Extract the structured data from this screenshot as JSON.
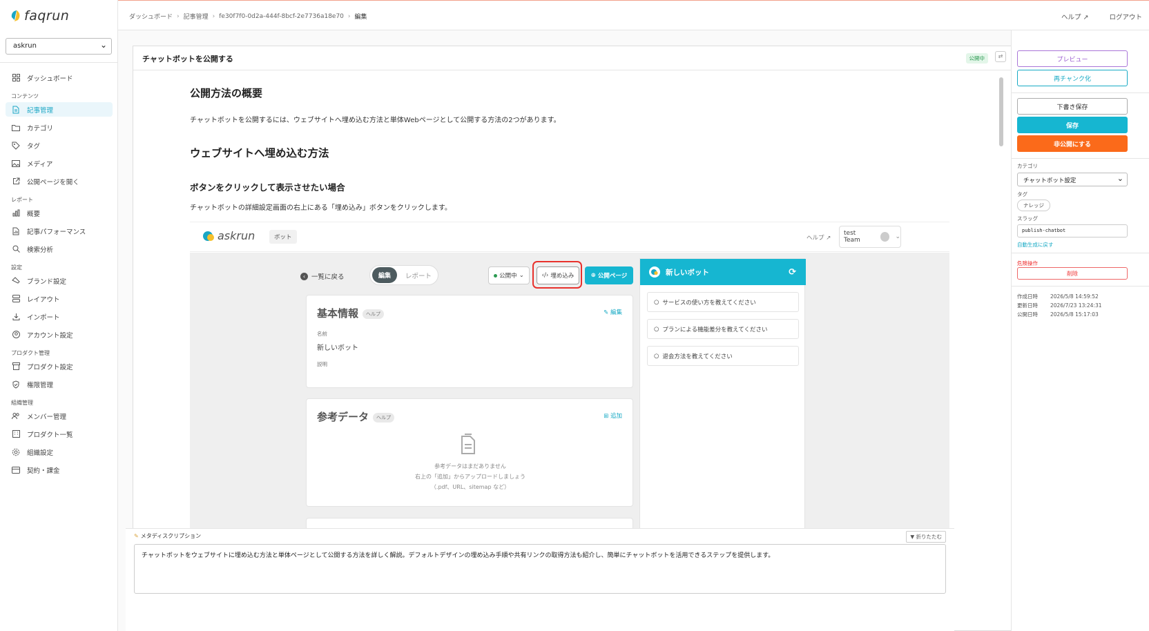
{
  "app": {
    "logo_text": "faqrun",
    "workspace": "askrun"
  },
  "sidebar": {
    "items": [
      {
        "label": "ダッシュボード",
        "icon": "grid-icon"
      }
    ],
    "sections": [
      {
        "title": "コンテンツ",
        "items": [
          "記事管理",
          "カテゴリ",
          "タグ",
          "メディア",
          "公開ページを開く"
        ]
      },
      {
        "title": "レポート",
        "items": [
          "概要",
          "記事パフォーマンス",
          "検索分析"
        ]
      },
      {
        "title": "設定",
        "items": [
          "ブランド設定",
          "レイアウト",
          "インポート",
          "アカウント設定"
        ]
      },
      {
        "title": "プロダクト管理",
        "items": [
          "プロダクト設定",
          "権限管理"
        ]
      },
      {
        "title": "組織管理",
        "items": [
          "メンバー管理",
          "プロダクト一覧",
          "組織設定",
          "契約・課金"
        ]
      }
    ]
  },
  "header": {
    "breadcrumb": [
      "ダッシュボード",
      "記事管理",
      "fe30f7f0-0d2a-444f-8bcf-2e7736a18e70",
      "編集"
    ],
    "help": "ヘルプ",
    "logout": "ログアウト"
  },
  "editor": {
    "title": "チャットボットを公開する",
    "status_badge": "公開中",
    "h_overview": "公開方法の概要",
    "p_overview": "チャットボットを公開するには、ウェブサイトへ埋め込む方法と単体Webページとして公開する方法の2つがあります。",
    "h_embed": "ウェブサイトへ埋め込む方法",
    "h_button": "ボタンをクリックして表示させたい場合",
    "p_button": "チャットボットの詳細設定画面の右上にある「埋め込み」ボタンをクリックします。"
  },
  "screenshot": {
    "logo_text": "askrun",
    "bot_chip": "ボット",
    "help": "ヘルプ ↗",
    "team": "test Team",
    "back": "一覧に戻る",
    "seg_edit": "編集",
    "seg_report": "レポート",
    "pub_select": "公開中",
    "embed": "埋め込み",
    "public_page": "公開ページ",
    "basic_title": "基本情報",
    "help_chip": "ヘルプ",
    "edit": "編集",
    "name_label": "名前",
    "name_value": "新しいボット",
    "desc_label": "説明",
    "ref_title": "参考データ",
    "add": "追加",
    "empty_1": "参考データはまだありません",
    "empty_2": "右上の「追加」からアップロードしましょう",
    "empty_3": "（.pdf、URL、sitemap など）",
    "chat_title": "新しいボット",
    "suggestions": [
      "サービスの使い方を教えてください",
      "プランによる機能差分を教えてください",
      "退会方法を教えてください"
    ]
  },
  "meta": {
    "label": "メタディスクリプション",
    "fold": "▼ 折りたたむ",
    "text": "チャットボットをウェブサイトに埋め込む方法と単体ページとして公開する方法を詳しく解説。デフォルトデザインの埋め込み手順や共有リンクの取得方法も紹介し、簡単にチャットボットを活用できるステップを提供します。"
  },
  "right_panel": {
    "preview": "プレビュー",
    "rechunk": "再チャンク化",
    "draft_save": "下書き保存",
    "save": "保存",
    "unpublish": "非公開にする",
    "category_label": "カテゴリ",
    "category_value": "チャットボット設定",
    "tag_label": "タグ",
    "tag_value": "ナレッジ",
    "slug_label": "スラッグ",
    "slug_value": "publish-chatbot",
    "regen": "自動生成に戻す",
    "danger_label": "危険操作",
    "delete": "削除",
    "created_label": "作成日時",
    "created": "2026/5/8 14:59:52",
    "updated_label": "更新日時",
    "updated": "2026/7/23 13:24:31",
    "published_label": "公開日時",
    "published": "2026/5/8 15:17:03"
  },
  "colors": {
    "accent": "#16b6d1",
    "danger": "#fb6a1a",
    "preview": "#9a5bd0"
  }
}
